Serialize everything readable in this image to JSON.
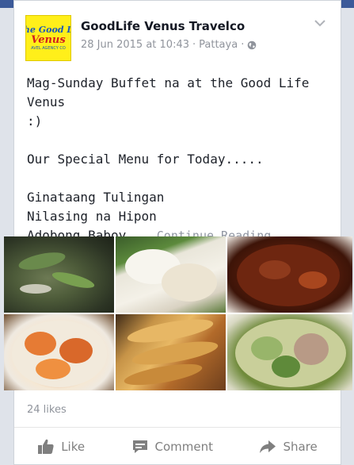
{
  "post": {
    "author": "GoodLife Venus Travelco",
    "date": "28 Jun 2015 at 10:43",
    "separator": "·",
    "location": "Pattaya",
    "separator2": "·",
    "lines": [
      "Mag-Sunday Buffet na at the Good Life Venus",
      ":)",
      "Our Special Menu for Today.....",
      "Ginataang Tulingan",
      "Nilasing na Hipon",
      "Adobong Baboy..."
    ],
    "continue_label": "Continue Reading"
  },
  "logo": {
    "line1": "he Good L",
    "line2": "Venus",
    "line3": "AVEL AGENCY CO"
  },
  "engagement": {
    "likes": "24 likes"
  },
  "actions": {
    "like": "Like",
    "comment": "Comment",
    "share": "Share"
  },
  "icons": {
    "privacy": "globe-icon",
    "menu": "chevron-down-icon",
    "like": "thumbs-up-icon",
    "comment": "comment-icon",
    "share": "share-arrow-icon"
  },
  "colors": {
    "brand": "#3c5a99",
    "muted_text": "#90949c",
    "logo_bg": "#ffef1a"
  }
}
